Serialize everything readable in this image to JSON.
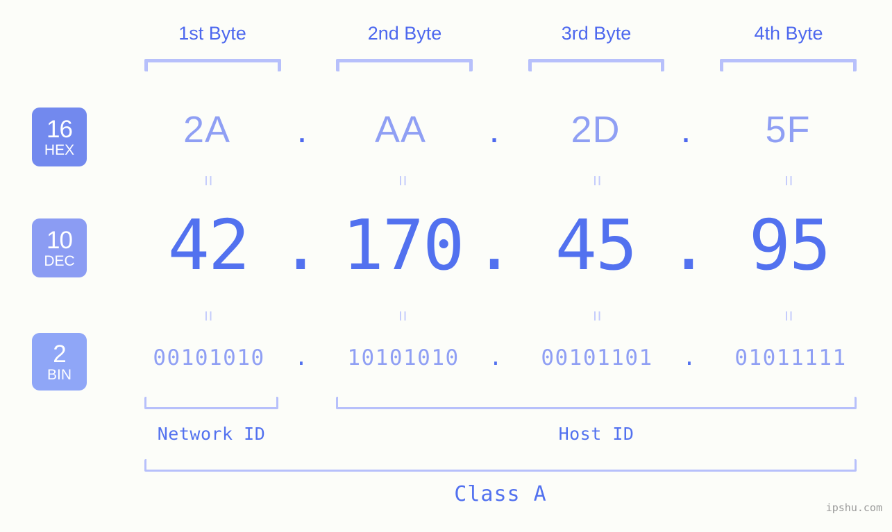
{
  "ip": {
    "dotted_decimal": "42.170.45.95",
    "class": "Class A"
  },
  "bytes": {
    "labels": [
      "1st Byte",
      "2nd Byte",
      "3rd Byte",
      "4th Byte"
    ]
  },
  "bases": [
    {
      "number": "16",
      "abbr": "HEX",
      "color": "#7289ee"
    },
    {
      "number": "10",
      "abbr": "DEC",
      "color": "#8b9cf3"
    },
    {
      "number": "2",
      "abbr": "BIN",
      "color": "#8fa6f7"
    }
  ],
  "rows": {
    "hex": [
      "2A",
      "AA",
      "2D",
      "5F"
    ],
    "dec": [
      "42",
      "170",
      "45",
      "95"
    ],
    "bin": [
      "00101010",
      "10101010",
      "00101101",
      "01011111"
    ]
  },
  "separator": ".",
  "equals_marker": "=",
  "segments": {
    "network_id": "Network ID",
    "host_id": "Host ID"
  },
  "watermark": "ipshu.com",
  "colors": {
    "background": "#fcfdf9",
    "accent_strong": "#4d68ee",
    "accent_mid": "#5271ef",
    "accent_light": "#8f9ff4",
    "bracket": "#b7c0fb",
    "equals": "#c3cbfc",
    "watermark": "#9a9a9a"
  }
}
